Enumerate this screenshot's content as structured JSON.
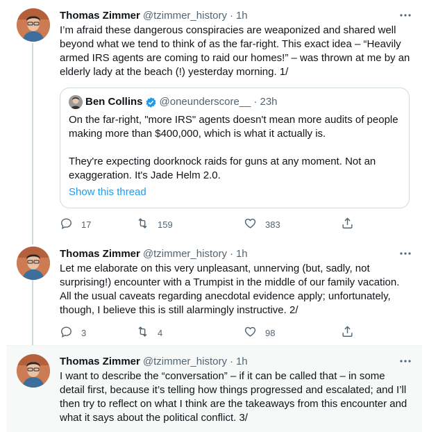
{
  "tweets": [
    {
      "name": "Thomas Zimmer",
      "handle": "@tzimmer_history",
      "dot": "·",
      "time": "1h",
      "text": "I’m afraid these dangerous conspiracies are weaponized and shared well beyond what we tend to think of as the far-right. This exact idea – “Heavily armed IRS agents are coming to raid our homes!” – was thrown at me by an elderly lady at the beach (!) yesterday morning. 1/",
      "quote": {
        "name": "Ben Collins",
        "handle": "@oneunderscore__",
        "dot": "·",
        "time": "23h",
        "para1": "On the far-right, \"more IRS\" agents doesn't mean more audits of people making more than $400,000, which is what it actually is.",
        "para2": "They're expecting doorknock raids for guns at any moment. Not an exaggeration. It's Jade Helm 2.0.",
        "show_thread": "Show this thread"
      },
      "replies": "17",
      "retweets": "159",
      "likes": "383"
    },
    {
      "name": "Thomas Zimmer",
      "handle": "@tzimmer_history",
      "dot": "·",
      "time": "1h",
      "text": "Let me elaborate on this very unpleasant, unnerving (but, sadly, not surprising!) encounter with a Trumpist in the middle of our family vacation. All the usual caveats regarding anecdotal evidence apply; unfortunately, though, I believe this is still alarmingly instructive. 2/",
      "replies": "3",
      "retweets": "4",
      "likes": "98"
    },
    {
      "name": "Thomas Zimmer",
      "handle": "@tzimmer_history",
      "dot": "·",
      "time": "1h",
      "text": "I want to describe the “conversation” – if it can be called that – in some detail first, because it’s telling how things progressed and escalated; and I’ll then try to reflect on what I think are the takeaways from this encounter and what it says about the political conflict. 3/"
    }
  ],
  "colors": {
    "accent": "#1d9bf0",
    "secondary_text": "#536471",
    "border": "#cfd9de",
    "highlight_bg": "#f7f9f9"
  },
  "icons": [
    "more-icon",
    "reply-icon",
    "retweet-icon",
    "like-icon",
    "share-icon",
    "verified-badge-icon"
  ]
}
